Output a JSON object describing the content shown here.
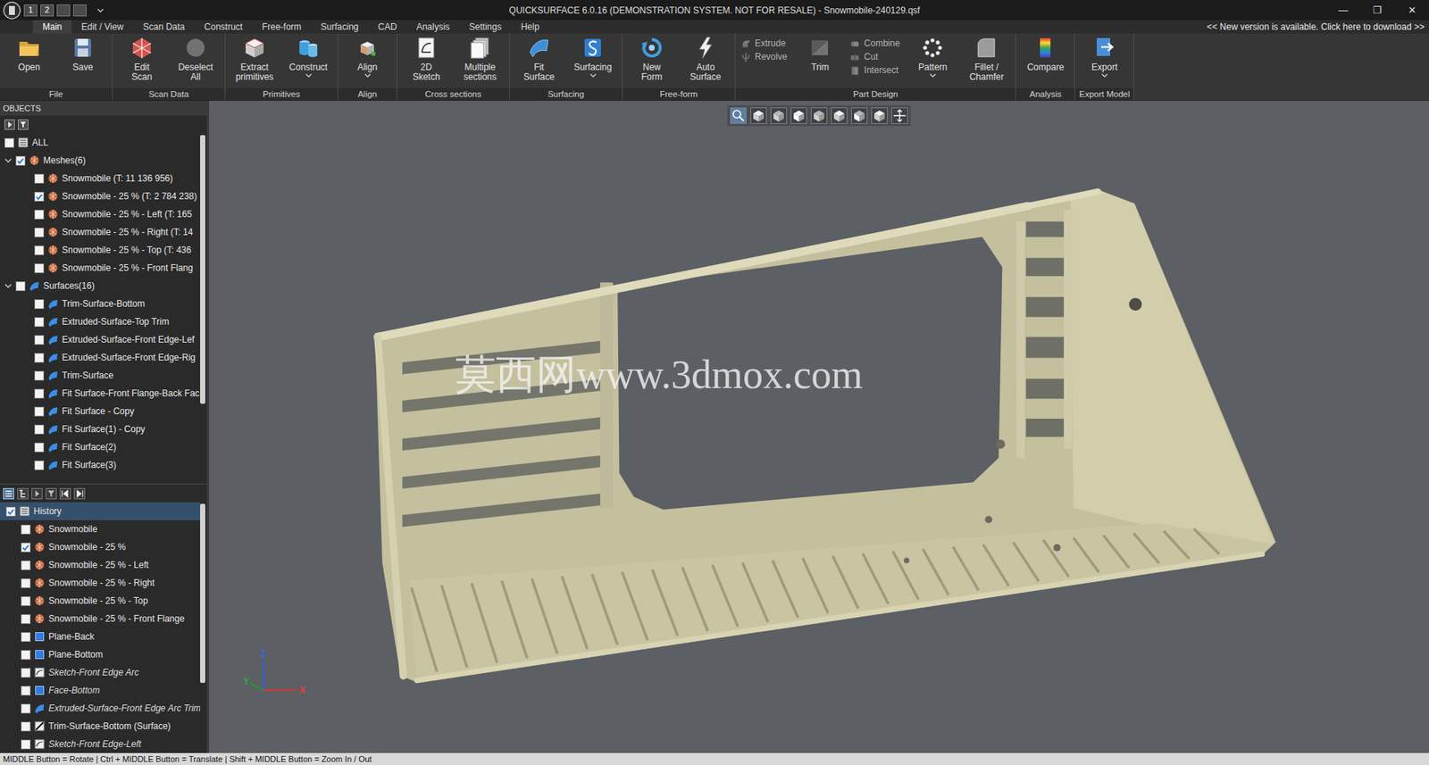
{
  "window": {
    "title": "QUICKSURFACE 6.0.16 (DEMONSTRATION SYSTEM. NOT FOR RESALE) - Snowmobile-240129.qsf",
    "quick_access": [
      "1",
      "2",
      "",
      ""
    ],
    "controls": [
      "—",
      "❐",
      "✕"
    ]
  },
  "menu": {
    "tabs": [
      {
        "label": "Main",
        "selected": true
      },
      {
        "label": "Edit / View",
        "selected": false
      },
      {
        "label": "Scan Data",
        "selected": false
      },
      {
        "label": "Construct",
        "selected": false
      },
      {
        "label": "Free-form",
        "selected": false
      },
      {
        "label": "Surfacing",
        "selected": false
      },
      {
        "label": "CAD",
        "selected": false
      },
      {
        "label": "Analysis",
        "selected": false
      },
      {
        "label": "Settings",
        "selected": false
      },
      {
        "label": "Help",
        "selected": false
      }
    ],
    "notice": "<< New version is available. Click here to download >>"
  },
  "ribbon": {
    "groups": [
      {
        "label": "File",
        "items": [
          {
            "kind": "large",
            "label": [
              "Open"
            ],
            "dropdown": false,
            "disabled": false
          },
          {
            "kind": "large",
            "label": [
              "Save"
            ],
            "dropdown": false,
            "disabled": false
          }
        ]
      },
      {
        "label": "Scan Data",
        "items": [
          {
            "kind": "large",
            "label": [
              "Edit",
              "Scan"
            ],
            "dropdown": false,
            "disabled": false
          },
          {
            "kind": "large",
            "label": [
              "Deselect",
              "All"
            ],
            "dropdown": false,
            "disabled": true
          }
        ]
      },
      {
        "label": "Primitives",
        "items": [
          {
            "kind": "large",
            "label": [
              "Extract",
              "primitives"
            ],
            "dropdown": false,
            "disabled": false
          },
          {
            "kind": "large",
            "label": [
              "Construct"
            ],
            "dropdown": true,
            "disabled": false
          }
        ]
      },
      {
        "label": "Align",
        "items": [
          {
            "kind": "large",
            "label": [
              "Align"
            ],
            "dropdown": true,
            "disabled": false
          }
        ]
      },
      {
        "label": "Cross sections",
        "items": [
          {
            "kind": "large",
            "label": [
              "2D",
              "Sketch"
            ],
            "dropdown": false,
            "disabled": false
          },
          {
            "kind": "large",
            "label": [
              "Multiple",
              "sections"
            ],
            "dropdown": false,
            "disabled": false
          }
        ]
      },
      {
        "label": "Surfacing",
        "items": [
          {
            "kind": "large",
            "label": [
              "Fit",
              "Surface"
            ],
            "dropdown": false,
            "disabled": false
          },
          {
            "kind": "large",
            "label": [
              "Surfacing"
            ],
            "dropdown": true,
            "disabled": false
          }
        ]
      },
      {
        "label": "Free-form",
        "items": [
          {
            "kind": "large",
            "label": [
              "New",
              "Form"
            ],
            "dropdown": false,
            "disabled": false
          },
          {
            "kind": "large",
            "label": [
              "Auto",
              "Surface"
            ],
            "dropdown": false,
            "disabled": false
          }
        ]
      },
      {
        "label": "Part Design",
        "items": [
          {
            "kind": "stack",
            "buttons": [
              {
                "label": "Extrude",
                "disabled": true
              },
              {
                "label": "Revolve",
                "disabled": true
              }
            ]
          },
          {
            "kind": "large",
            "label": [
              "Trim"
            ],
            "dropdown": false,
            "disabled": true
          },
          {
            "kind": "stack",
            "buttons": [
              {
                "label": "Combine",
                "disabled": true
              },
              {
                "label": "Cut",
                "disabled": true
              },
              {
                "label": "Intersect",
                "disabled": true
              }
            ]
          },
          {
            "kind": "large",
            "label": [
              "Pattern"
            ],
            "dropdown": true,
            "disabled": false
          },
          {
            "kind": "large",
            "label": [
              "Fillet /",
              "Chamfer"
            ],
            "dropdown": false,
            "disabled": false
          }
        ]
      },
      {
        "label": "Analysis",
        "items": [
          {
            "kind": "large",
            "label": [
              "Compare"
            ],
            "dropdown": false,
            "disabled": false
          }
        ]
      },
      {
        "label": "Export Model",
        "items": [
          {
            "kind": "large",
            "label": [
              "Export"
            ],
            "dropdown": true,
            "disabled": false
          }
        ]
      }
    ]
  },
  "objects": {
    "title": "OBJECTS",
    "tree": [
      {
        "label": "ALL",
        "kind": "all",
        "checked": false
      },
      {
        "label": "Meshes(6)",
        "kind": "mesh",
        "checked": true,
        "expanded": true,
        "children": [
          {
            "label": "Snowmobile (T: 11 136 956)",
            "kind": "mesh",
            "checked": false
          },
          {
            "label": "Snowmobile - 25 % (T: 2 784 238)",
            "kind": "mesh",
            "checked": true
          },
          {
            "label": "Snowmobile - 25 % - Left (T: 165",
            "kind": "mesh",
            "checked": false
          },
          {
            "label": "Snowmobile - 25 % - Right (T: 14",
            "kind": "mesh",
            "checked": false
          },
          {
            "label": "Snowmobile - 25 % - Top (T: 436",
            "kind": "mesh",
            "checked": false
          },
          {
            "label": "Snowmobile - 25 % - Front Flang",
            "kind": "mesh",
            "checked": false
          }
        ]
      },
      {
        "label": "Surfaces(16)",
        "kind": "surface",
        "checked": false,
        "expanded": true,
        "children": [
          {
            "label": "Trim-Surface-Bottom",
            "kind": "surface",
            "checked": false
          },
          {
            "label": "Extruded-Surface-Top Trim",
            "kind": "surface",
            "checked": false
          },
          {
            "label": "Extruded-Surface-Front Edge-Lef",
            "kind": "surface",
            "checked": false
          },
          {
            "label": "Extruded-Surface-Front Edge-Rig",
            "kind": "surface",
            "checked": false
          },
          {
            "label": "Trim-Surface",
            "kind": "surface",
            "checked": false
          },
          {
            "label": "Fit Surface-Front Flange-Back Fac",
            "kind": "surface",
            "checked": false
          },
          {
            "label": "Fit Surface - Copy",
            "kind": "surface",
            "checked": false
          },
          {
            "label": "Fit Surface(1) - Copy",
            "kind": "surface",
            "checked": false
          },
          {
            "label": "Fit Surface(2)",
            "kind": "surface",
            "checked": false
          },
          {
            "label": "Fit Surface(3)",
            "kind": "surface",
            "checked": false
          }
        ]
      }
    ]
  },
  "history": {
    "toolbar": [
      {
        "selected": true
      },
      {
        "selected": false
      },
      {
        "selected": false
      },
      {
        "selected": false
      },
      {
        "selected": false
      },
      {
        "selected": false
      }
    ],
    "items": [
      {
        "label": "History",
        "kind": "list",
        "checked": true,
        "selected": true,
        "inactive": false
      },
      {
        "label": "Snowmobile",
        "kind": "mesh",
        "checked": false,
        "selected": false,
        "inactive": false
      },
      {
        "label": "Snowmobile - 25 %",
        "kind": "mesh",
        "checked": true,
        "selected": false,
        "inactive": false
      },
      {
        "label": "Snowmobile - 25 % - Left",
        "kind": "mesh",
        "checked": false,
        "selected": false,
        "inactive": false
      },
      {
        "label": "Snowmobile - 25 % - Right",
        "kind": "mesh",
        "checked": false,
        "selected": false,
        "inactive": false
      },
      {
        "label": "Snowmobile - 25 % - Top",
        "kind": "mesh",
        "checked": false,
        "selected": false,
        "inactive": false
      },
      {
        "label": "Snowmobile - 25 % - Front Flange",
        "kind": "mesh",
        "checked": false,
        "selected": false,
        "inactive": false
      },
      {
        "label": "Plane-Back",
        "kind": "plane",
        "checked": false,
        "selected": false,
        "inactive": false
      },
      {
        "label": "Plane-Bottom",
        "kind": "plane",
        "checked": false,
        "selected": false,
        "inactive": false
      },
      {
        "label": "Sketch-Front Edge Arc",
        "kind": "sketch",
        "checked": false,
        "selected": false,
        "inactive": true
      },
      {
        "label": "Face-Bottom",
        "kind": "face",
        "checked": false,
        "selected": false,
        "inactive": true
      },
      {
        "label": "Extruded-Surface-Front Edge Arc Trim",
        "kind": "surface",
        "checked": false,
        "selected": false,
        "inactive": true
      },
      {
        "label": "Trim-Surface-Bottom (Surface)",
        "kind": "trim",
        "checked": false,
        "selected": false,
        "inactive": false
      },
      {
        "label": "Sketch-Front Edge-Left",
        "kind": "sketch",
        "checked": false,
        "selected": false,
        "inactive": true
      }
    ]
  },
  "viewport": {
    "watermark": "莫西网www.3dmox.com",
    "axes": [
      "Z",
      "Y",
      "X"
    ]
  },
  "status_bar": "MIDDLE Button = Rotate | Ctrl + MIDDLE Button = Translate | Shift + MIDDLE Button = Zoom In / Out"
}
